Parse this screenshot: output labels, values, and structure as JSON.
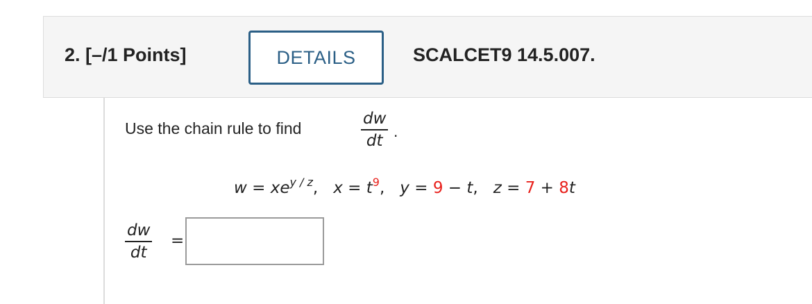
{
  "header": {
    "question_label": "2. [–/1 Points]",
    "details_button": "DETAILS",
    "problem_code": "SCALCET9 14.5.007."
  },
  "question": {
    "instruction": "Use the chain rule to find",
    "fraction_numerator": "dw",
    "fraction_denominator": "dt",
    "instruction_end": ".",
    "equation": {
      "w_lhs": "w",
      "w_equals": " = ",
      "w_x": "xe",
      "w_exp": "y / z",
      "sep1": ",",
      "x_lhs": "x",
      "x_equals": " = ",
      "x_base": "t",
      "x_exp": "9",
      "sep2": ",",
      "y_lhs": "y",
      "y_equals": " = ",
      "y_const": "9",
      "y_minus": " − ",
      "y_var": "t",
      "sep3": ",",
      "z_lhs": "z",
      "z_equals": " = ",
      "z_const": "7",
      "z_plus": " + ",
      "z_coef": "8",
      "z_var": "t"
    }
  },
  "answer": {
    "fraction_numerator": "dw",
    "fraction_denominator": "dt",
    "equals": "=",
    "input_value": ""
  },
  "colors": {
    "accent": "#2b5f86",
    "randomized_value": "#e8211c",
    "header_background": "#f5f5f5"
  }
}
